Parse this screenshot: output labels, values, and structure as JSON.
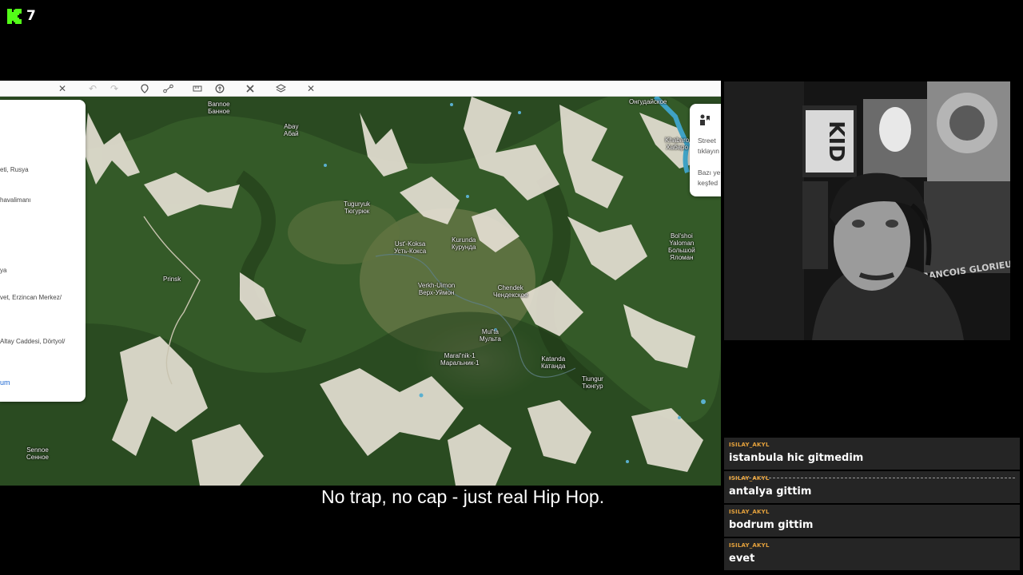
{
  "stream": {
    "viewer_count": "7",
    "brand_color": "#53fc18"
  },
  "subtitle": "No trap, no cap - just real Hip Hop.",
  "map": {
    "toolbar_icons": [
      "close-icon",
      "undo-icon",
      "redo-icon",
      "marker-icon",
      "route-icon",
      "ruler-icon",
      "satellite-icon",
      "tools-icon",
      "layers-icon",
      "close-icon"
    ],
    "labels": [
      {
        "id": "bannoe",
        "text": "Bannoe\nБанное"
      },
      {
        "id": "abay",
        "text": "Abay\nАбай"
      },
      {
        "id": "ongudaiskoe",
        "text": "Онгудайское"
      },
      {
        "id": "khabarovka",
        "text": "Khabaro\nХабаро"
      },
      {
        "id": "tuguryuk",
        "text": "Tuguryuk\nТюгурюк"
      },
      {
        "id": "ust-koksa",
        "text": "Ust'-Koksa\nУсть-Кокса"
      },
      {
        "id": "kurunda",
        "text": "Kurunda\nКурунда"
      },
      {
        "id": "bolshoi-yaloman",
        "text": "Bol'shoi\nYaloman\nБольшой\nЯломан"
      },
      {
        "id": "prinsk",
        "text": "Prinsk"
      },
      {
        "id": "verkh-uimon",
        "text": "Verkh-Uimon\nВерх-Уймон"
      },
      {
        "id": "chendek",
        "text": "Chendek\nЧендекское"
      },
      {
        "id": "multa",
        "text": "Mul'ta\nМульта"
      },
      {
        "id": "maralnik",
        "text": "Maral'nik-1\nМаральник-1"
      },
      {
        "id": "katanda",
        "text": "Katanda\nКатанда"
      },
      {
        "id": "tiungur",
        "text": "Tiungur\nТюнгур"
      },
      {
        "id": "sennoe",
        "text": "Sennoe\nСенное"
      }
    ],
    "search_panel": {
      "items": [
        "eti, Rusya",
        "havalimanı",
        "ya",
        "vet, Erzincan Merkez/",
        "Altay Caddesi, Dörtyol/",
        "um"
      ]
    },
    "street_view_card": {
      "line1": "Street",
      "line2": "tıklayın",
      "line3": "Bazı ye",
      "line4": "keşfed"
    }
  },
  "chat": {
    "messages": [
      {
        "user": "ISILAY_AKYL",
        "text": "istanbula hic gitmedim"
      },
      {
        "user": "ISILAY_AKYL",
        "text": "antalya gittim"
      },
      {
        "user": "ISILAY_AKYL",
        "text": "bodrum gittim"
      },
      {
        "user": "ISILAY_AKYL",
        "text": "evet"
      }
    ]
  }
}
